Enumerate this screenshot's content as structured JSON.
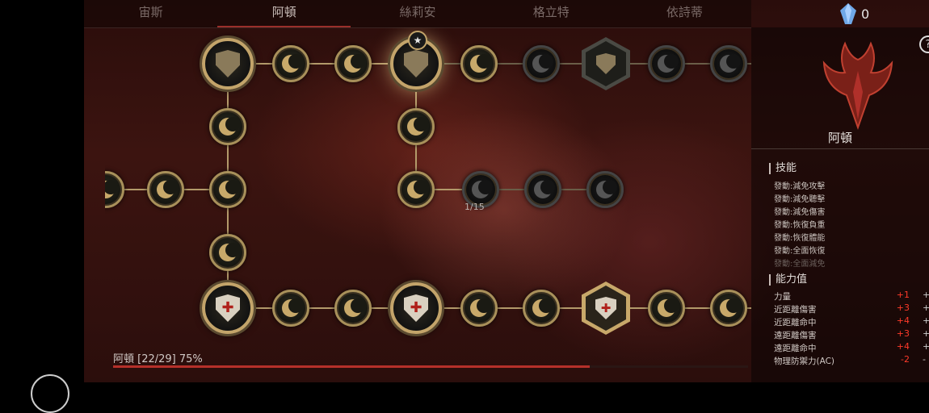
{
  "tabs": [
    {
      "label": "宙斯",
      "active": false
    },
    {
      "label": "阿頓",
      "active": true
    },
    {
      "label": "絲莉安",
      "active": false
    },
    {
      "label": "格立特",
      "active": false
    },
    {
      "label": "依詩蒂",
      "active": false
    }
  ],
  "currency": {
    "value": "0",
    "icon": "blue-crystal-icon"
  },
  "tree": {
    "node_progress_label": "1/15"
  },
  "footer": {
    "progress_text": "阿頓 [22/29] 75%",
    "progress_fraction": 0.75
  },
  "panel": {
    "character_name": "阿頓",
    "help_label": "?",
    "skills_title": "技能",
    "skills": [
      {
        "text": "發動:減免攻擊",
        "dim": false
      },
      {
        "text": "發動:減免聽擊",
        "dim": false
      },
      {
        "text": "發動:減免傷害",
        "dim": false
      },
      {
        "text": "發動:恢復負重",
        "dim": false
      },
      {
        "text": "發動:恢復體能",
        "dim": false
      },
      {
        "text": "發動:全面恢復",
        "dim": false
      },
      {
        "text": "發動:全面減免",
        "dim": true
      }
    ],
    "stats_title": "能力值",
    "stats": [
      {
        "name": "力量",
        "value": "+1",
        "extra": "+"
      },
      {
        "name": "近距離傷害",
        "value": "+3",
        "extra": "+"
      },
      {
        "name": "近距離命中",
        "value": "+4",
        "extra": "+"
      },
      {
        "name": "遠距離傷害",
        "value": "+3",
        "extra": "+"
      },
      {
        "name": "遠距離命中",
        "value": "+4",
        "extra": "+"
      },
      {
        "name": "物理防禦力(AC)",
        "value": "-2",
        "extra": "-"
      }
    ]
  },
  "colors": {
    "accent": "#b5302a",
    "gold": "#c3a46a",
    "stat_bonus": "#ff3a2a"
  }
}
